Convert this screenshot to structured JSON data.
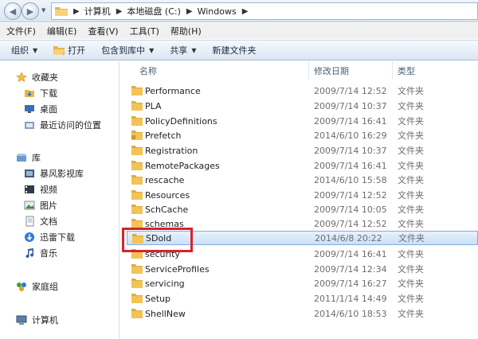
{
  "address": {
    "crumbs": [
      "计算机",
      "本地磁盘 (C:)",
      "Windows"
    ]
  },
  "menu": [
    "文件(F)",
    "编辑(E)",
    "查看(V)",
    "工具(T)",
    "帮助(H)"
  ],
  "toolbar": {
    "organize": "组织",
    "open": "打开",
    "include_in_library": "包含到库中",
    "share": "共享",
    "new_folder": "新建文件夹"
  },
  "nav": {
    "favorites": "收藏夹",
    "downloads": "下载",
    "desktop": "桌面",
    "recent": "最近访问的位置",
    "libraries": "库",
    "storm": "暴风影视库",
    "videos": "视频",
    "pictures": "图片",
    "documents": "文档",
    "thunder": "迅雷下载",
    "music": "音乐",
    "homegroup": "家庭组",
    "computer": "计算机"
  },
  "columns": {
    "name": "名称",
    "date": "修改日期",
    "type": "类型"
  },
  "files": [
    {
      "name": "Performance",
      "date": "2009/7/14 12:52",
      "type": "文件夹",
      "locked": false
    },
    {
      "name": "PLA",
      "date": "2009/7/14 10:37",
      "type": "文件夹",
      "locked": false
    },
    {
      "name": "PolicyDefinitions",
      "date": "2009/7/14 16:41",
      "type": "文件夹",
      "locked": false
    },
    {
      "name": "Prefetch",
      "date": "2014/6/10 16:29",
      "type": "文件夹",
      "locked": true
    },
    {
      "name": "Registration",
      "date": "2009/7/14 10:37",
      "type": "文件夹",
      "locked": false
    },
    {
      "name": "RemotePackages",
      "date": "2009/7/14 16:41",
      "type": "文件夹",
      "locked": false
    },
    {
      "name": "rescache",
      "date": "2014/6/10 15:58",
      "type": "文件夹",
      "locked": false
    },
    {
      "name": "Resources",
      "date": "2009/7/14 12:52",
      "type": "文件夹",
      "locked": false
    },
    {
      "name": "SchCache",
      "date": "2009/7/14 10:05",
      "type": "文件夹",
      "locked": false
    },
    {
      "name": "schemas",
      "date": "2009/7/14 12:52",
      "type": "文件夹",
      "locked": false
    },
    {
      "name": "SDold",
      "date": "2014/6/8 20:22",
      "type": "文件夹",
      "locked": false
    },
    {
      "name": "security",
      "date": "2009/7/14 16:41",
      "type": "文件夹",
      "locked": false
    },
    {
      "name": "ServiceProfiles",
      "date": "2009/7/14 12:34",
      "type": "文件夹",
      "locked": false
    },
    {
      "name": "servicing",
      "date": "2009/7/14 16:27",
      "type": "文件夹",
      "locked": false
    },
    {
      "name": "Setup",
      "date": "2011/1/14 14:49",
      "type": "文件夹",
      "locked": false
    },
    {
      "name": "ShellNew",
      "date": "2014/6/10 18:53",
      "type": "文件夹",
      "locked": false
    }
  ],
  "colors": {
    "highlight_box": "#d8232a",
    "folder": "#f2c355",
    "selected_row": "#c9e0f7"
  }
}
